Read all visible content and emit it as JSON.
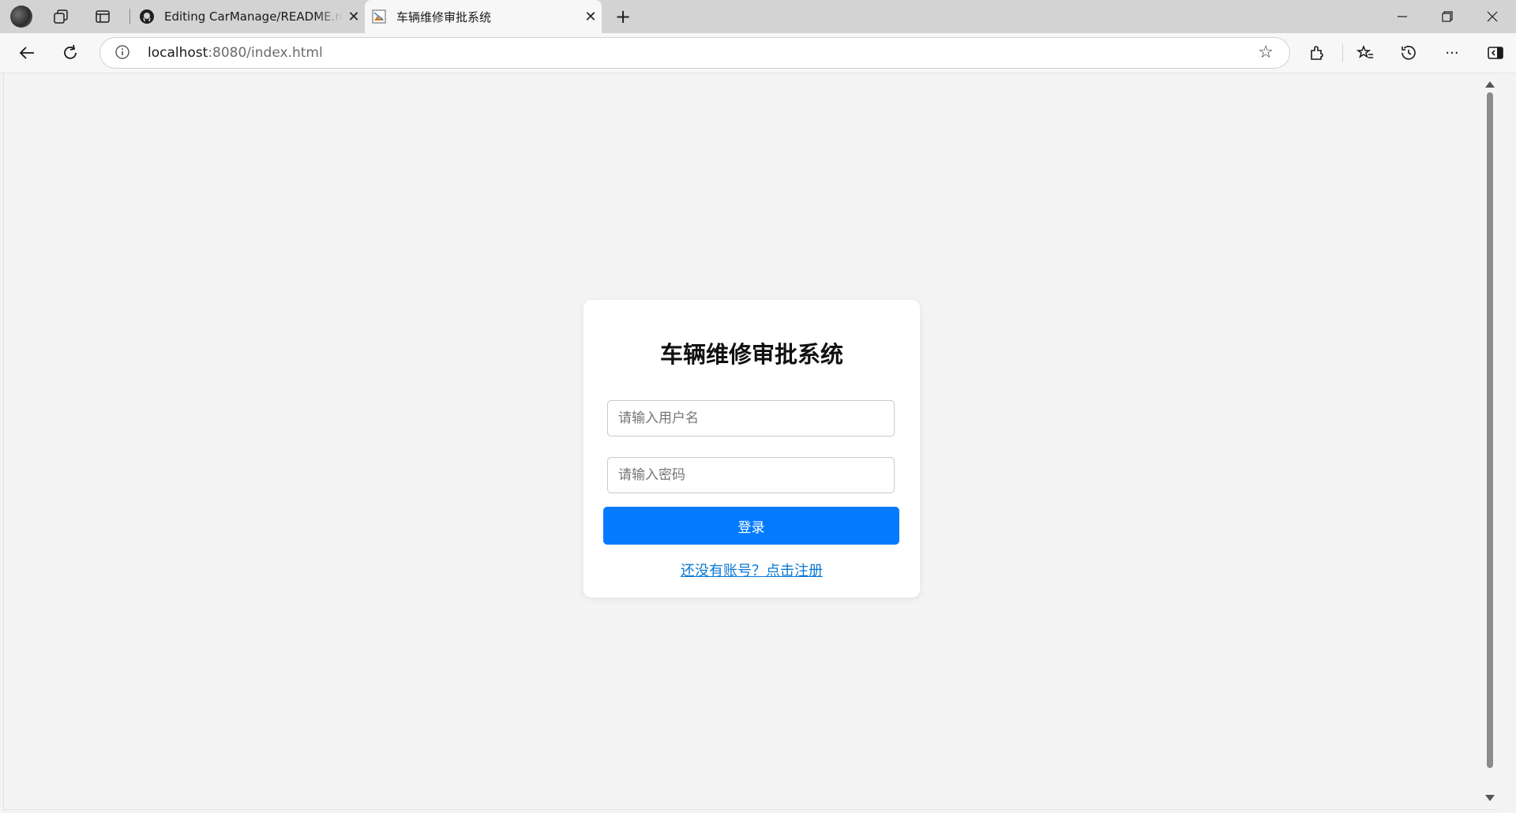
{
  "browser": {
    "tabs": [
      {
        "title": "Editing CarManage/README.md",
        "icon": "github-icon"
      },
      {
        "title": "车辆维修审批系统",
        "icon": "broken-image-icon"
      }
    ],
    "url_host": "localhost",
    "url_rest": ":8080/index.html"
  },
  "login": {
    "title": "车辆维修审批系统",
    "username_placeholder": "请输入用户名",
    "password_placeholder": "请输入密码",
    "login_label": "登录",
    "register_link": "还没有账号？点击注册"
  },
  "colors": {
    "primary": "#047bff",
    "link": "#0a78d4",
    "page_bg": "#f4f4f4"
  }
}
